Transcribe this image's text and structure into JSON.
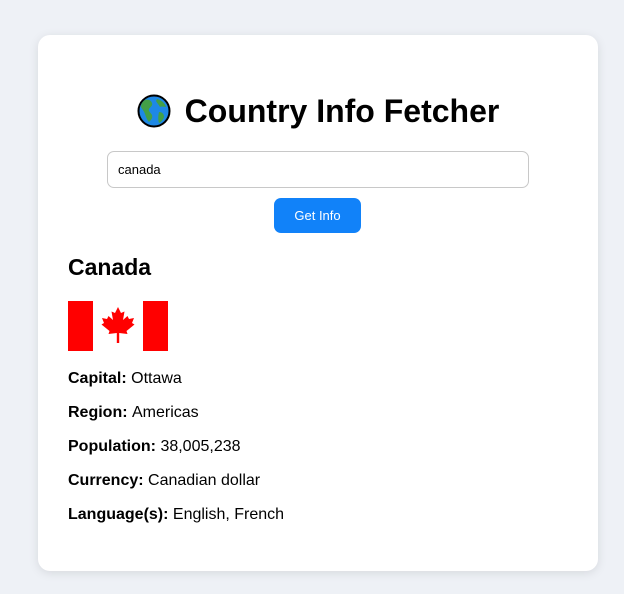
{
  "app": {
    "title": "Country Info Fetcher",
    "title_icon": "globe-americas-icon"
  },
  "search": {
    "value": "canada",
    "button_label": "Get Info"
  },
  "country": {
    "name": "Canada",
    "flag_icon": "canada-flag",
    "fields": [
      {
        "label": "Capital:",
        "value": "Ottawa"
      },
      {
        "label": "Region:",
        "value": "Americas"
      },
      {
        "label": "Population:",
        "value": "38,005,238"
      },
      {
        "label": "Currency:",
        "value": "Canadian dollar"
      },
      {
        "label": "Language(s):",
        "value": "English, French"
      }
    ]
  },
  "colors": {
    "page_background": "#eef1f6",
    "card_background": "#ffffff",
    "button": "#1182f9",
    "flag_red": "#ff0000"
  }
}
